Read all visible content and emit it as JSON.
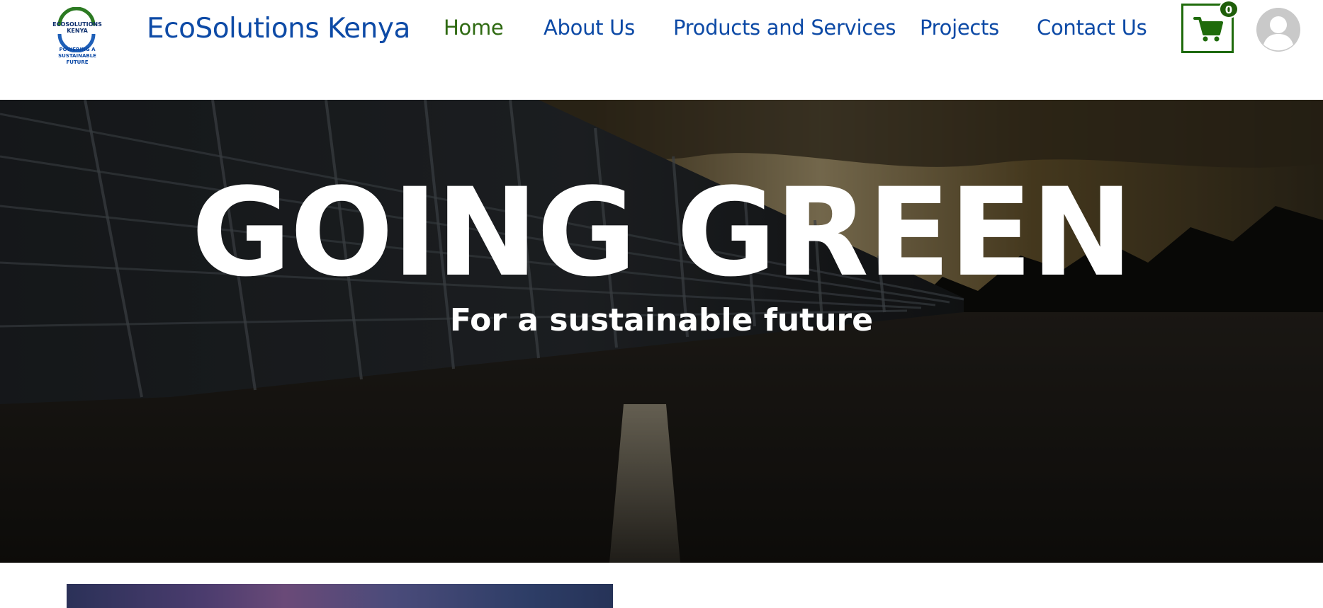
{
  "header": {
    "logo": {
      "text_line1": "ECOSOLUTIONS",
      "text_line2": "KENYA",
      "tagline_line1": "POWERING A SUSTAINABLE",
      "tagline_line2": "FUTURE"
    },
    "brand": "EcoSolutions Kenya",
    "nav": [
      {
        "label": "Home",
        "active": true
      },
      {
        "label": "About Us",
        "active": false
      },
      {
        "label": "Products and Services",
        "active": false
      },
      {
        "label": "Projects",
        "active": false
      },
      {
        "label": "Contact Us",
        "active": false
      }
    ],
    "cart_count": "0",
    "icons": {
      "cart": "cart-icon",
      "avatar": "user-avatar-icon"
    }
  },
  "hero": {
    "title": "GOING GREEN",
    "subtitle": "For a sustainable future"
  },
  "colors": {
    "brand_blue": "#0d4aa6",
    "active_green": "#2f6a12",
    "cart_green": "#1f6b0b"
  }
}
